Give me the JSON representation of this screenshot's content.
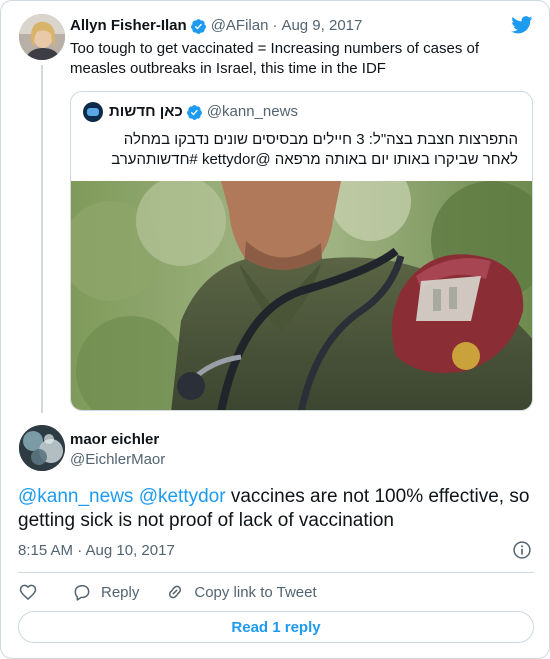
{
  "parent_tweet": {
    "author_name": "Allyn Fisher-Ilan",
    "handle": "@AFilan",
    "date": "Aug 9, 2017",
    "text": "Too tough to get vaccinated = Increasing numbers of cases of measles outbreaks in Israel, this time in the IDF",
    "quoted_tweet": {
      "author_name": "כאן חדשות",
      "handle": "@kann_news",
      "text": "התפרצות חצבת בצה\"ל: 3 חיילים מבסיסים שונים נדבקו במחלה לאחר שביקרו באותו יום באותה מרפאה @kettydor #חדשותהערב"
    }
  },
  "main_tweet": {
    "author_name": "maor eichler",
    "handle": "@EichlerMaor",
    "mention_1": "@kann_news",
    "mention_2": "@kettydor",
    "text_rest": " vaccines are not 100% effective, so getting sick is not proof of lack of vaccination",
    "timestamp": "8:15 AM · Aug 10, 2017"
  },
  "actions": {
    "reply_label": "Reply",
    "copy_link_label": "Copy link to Tweet"
  },
  "read_replies_label": "Read 1 reply",
  "icons": {
    "like": "heart-icon",
    "reply": "speech-bubble-icon",
    "copy_link": "link-icon",
    "info": "info-icon",
    "logo": "twitter-bird-icon",
    "verified": "verified-badge-icon"
  },
  "colors": {
    "accent": "#1d9bf0",
    "muted_text": "#536471",
    "border": "#cfd9de"
  }
}
